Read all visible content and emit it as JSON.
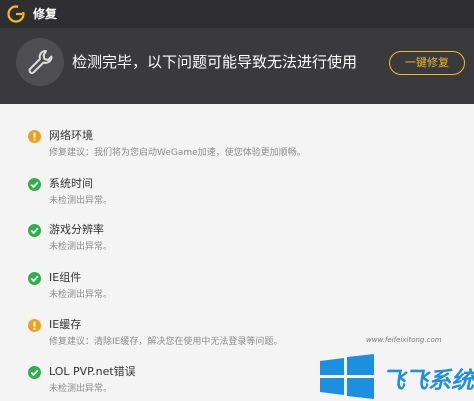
{
  "window": {
    "title": "修复"
  },
  "header": {
    "message": "检测完毕，以下问题可能导致无法进行使用",
    "fix_button": "一键修复"
  },
  "items": [
    {
      "status": "warning",
      "title": "网络环境",
      "desc": "修复建议：我们将为您启动WeGame加速，使您体验更加顺畅。"
    },
    {
      "status": "ok",
      "title": "系统时间",
      "desc": "未检测出异常。"
    },
    {
      "status": "ok",
      "title": "游戏分辨率",
      "desc": "未检测出异常。"
    },
    {
      "status": "ok",
      "title": "IE组件",
      "desc": "未检测出异常。"
    },
    {
      "status": "warning",
      "title": "IE缓存",
      "desc": "修复建议：清除IE缓存，解决您在使用中无法登录等问题。"
    },
    {
      "status": "ok",
      "title": "LOL PVP.net错误",
      "desc": "未检测出异常。"
    }
  ],
  "watermark": {
    "text": "飞飞系统",
    "url": "www.feifeixitong.com"
  },
  "colors": {
    "titlebar": "#2f2f31",
    "header": "#3a3a3c",
    "accent": "#f2b92b",
    "ok": "#2fae4a",
    "warning": "#f0a020"
  },
  "icons": {
    "logo": "wegame-logo-icon",
    "header": "wrench-icon",
    "ok": "check-icon",
    "warning": "exclamation-icon"
  }
}
